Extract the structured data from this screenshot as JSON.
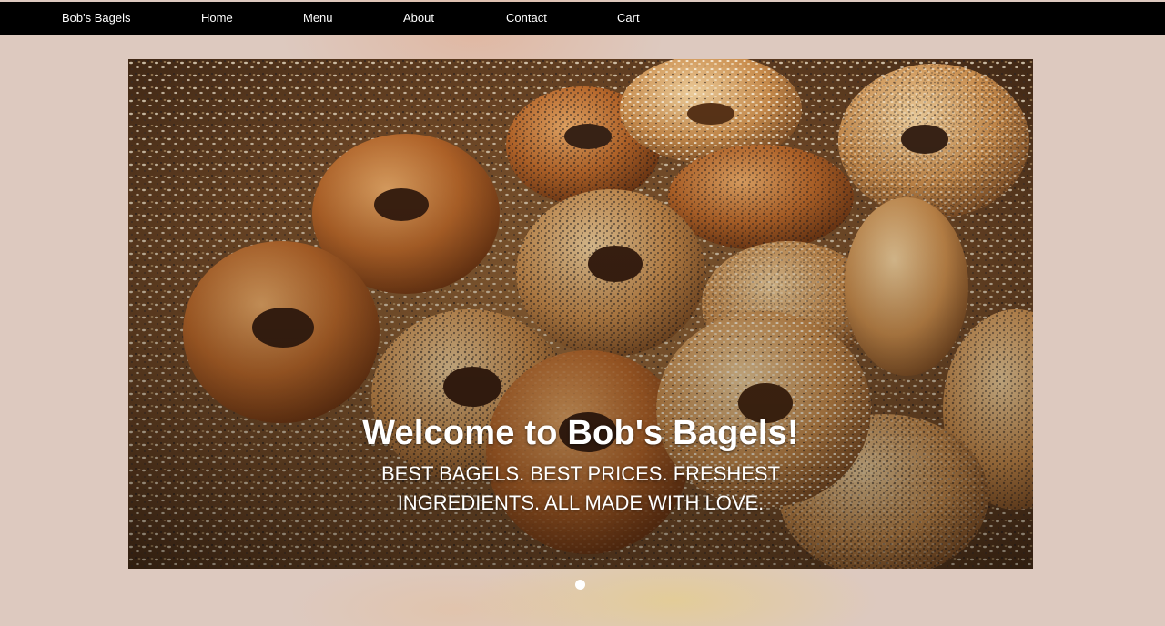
{
  "nav": {
    "brand": "Bob's Bagels",
    "items": [
      {
        "label": "Home"
      },
      {
        "label": "Menu"
      },
      {
        "label": "About"
      },
      {
        "label": "Contact"
      },
      {
        "label": "Cart"
      }
    ]
  },
  "hero": {
    "title": "Welcome to Bob's Bagels!",
    "subtitle": "BEST BAGELS. BEST PRICES. FRESHEST INGREDIENTS. ALL MADE WITH LOVE."
  },
  "carousel": {
    "slide_count": 1,
    "active_index": 0
  },
  "colors": {
    "nav_background": "#000000",
    "page_background": "#ddc9bf",
    "text_on_dark": "#ffffff"
  }
}
